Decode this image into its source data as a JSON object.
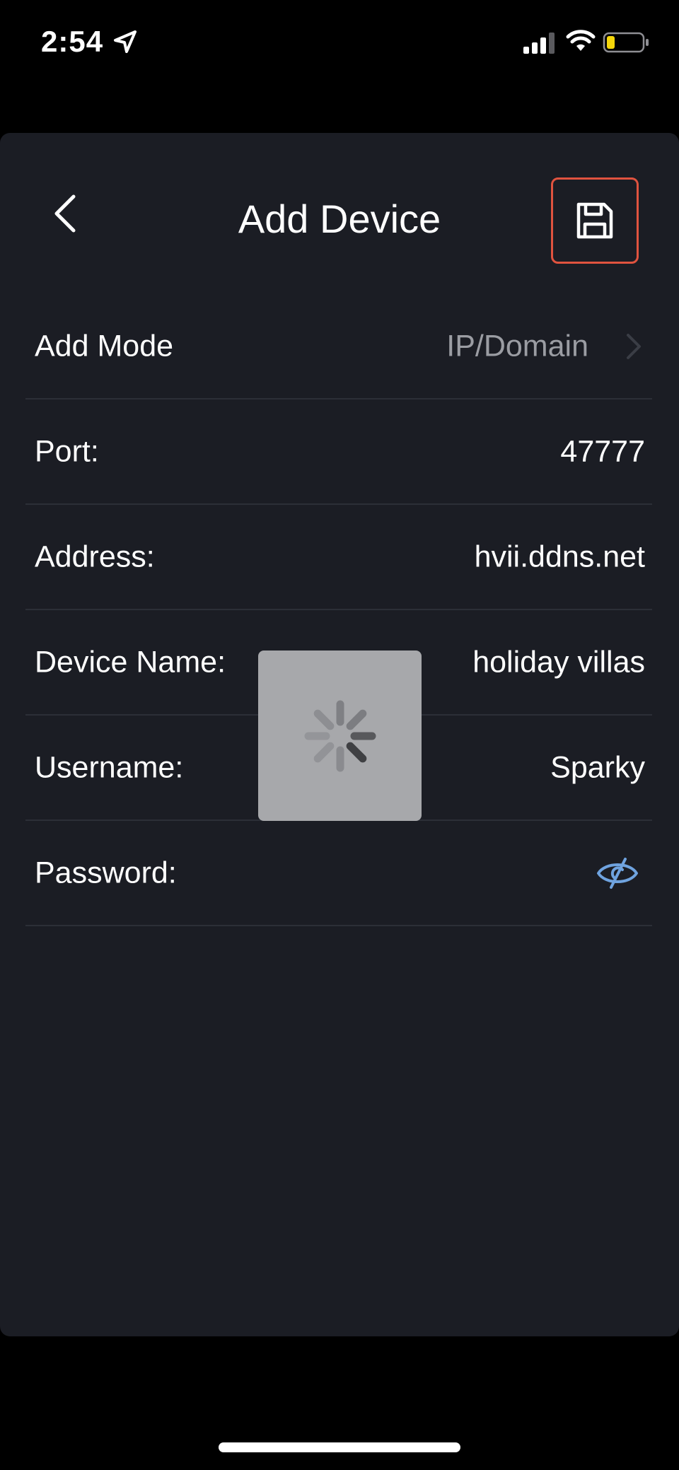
{
  "status_bar": {
    "time": "2:54",
    "location_icon": "location-arrow-icon",
    "signal_icon": "cellular-signal-icon",
    "wifi_icon": "wifi-icon",
    "battery_icon": "battery-low-icon",
    "battery_color": "#f5d60a"
  },
  "header": {
    "title": "Add Device",
    "back_icon": "chevron-left-icon",
    "save_icon": "floppy-disk-icon",
    "save_highlight_color": "#e0533f"
  },
  "form": {
    "rows": [
      {
        "label": "Add Mode",
        "value": "IP/Domain"
      },
      {
        "label": "Port:",
        "value": "47777"
      },
      {
        "label": "Address:",
        "value": "hvii.ddns.net"
      },
      {
        "label": "Device Name:",
        "value": "holiday villas"
      },
      {
        "label": "Username:",
        "value": "Sparky"
      },
      {
        "label": "Password:",
        "value": ""
      }
    ],
    "password_toggle_icon": "eye-slash-icon",
    "password_toggle_color": "#6fa3df"
  },
  "loading": {
    "icon": "spinner-icon"
  },
  "colors": {
    "panel_background": "#1b1d24",
    "screen_background": "#000000",
    "divider": "#2c2f37"
  }
}
